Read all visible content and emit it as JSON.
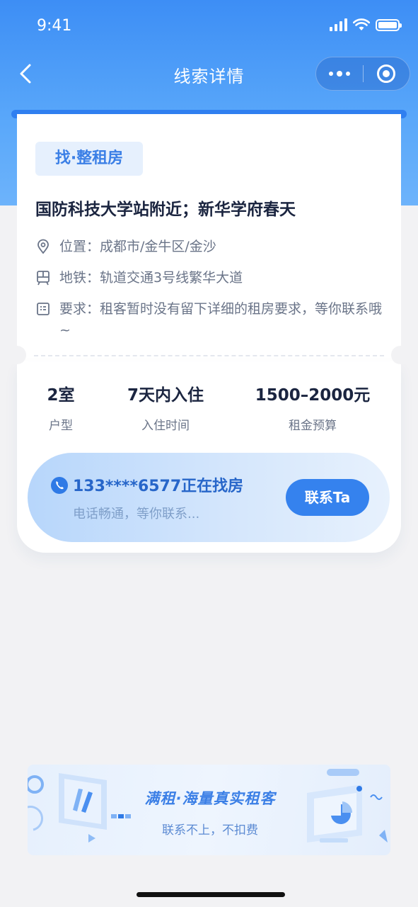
{
  "status_bar": {
    "time": "9:41"
  },
  "nav": {
    "title": "线索详情"
  },
  "lead": {
    "tag": "找·整租房",
    "title": "国防科技大学站附近；新华学府春天",
    "location": "位置：成都市/金牛区/金沙",
    "subway": "地铁：轨道交通3号线繁华大道",
    "requirement": "要求：租客暂时没有留下详细的租房要求，等你联系哦~"
  },
  "stats": [
    {
      "value": "2室",
      "label": "户型"
    },
    {
      "value": "7天内入住",
      "label": "入住时间"
    },
    {
      "value": "1500–2000元",
      "label": "租金预算"
    }
  ],
  "contact": {
    "headline": "133****6577正在找房",
    "subtext": "电话畅通，等你联系...",
    "button": "联系Ta"
  },
  "banner": {
    "title": "满租·海量真实租客",
    "subtitle": "联系不上，不扣费"
  },
  "colors": {
    "primary": "#3582ee",
    "header_gradient_top": "#3d8ef5",
    "tag_bg": "#e6f0fd",
    "page_bg": "#f2f2f4"
  }
}
